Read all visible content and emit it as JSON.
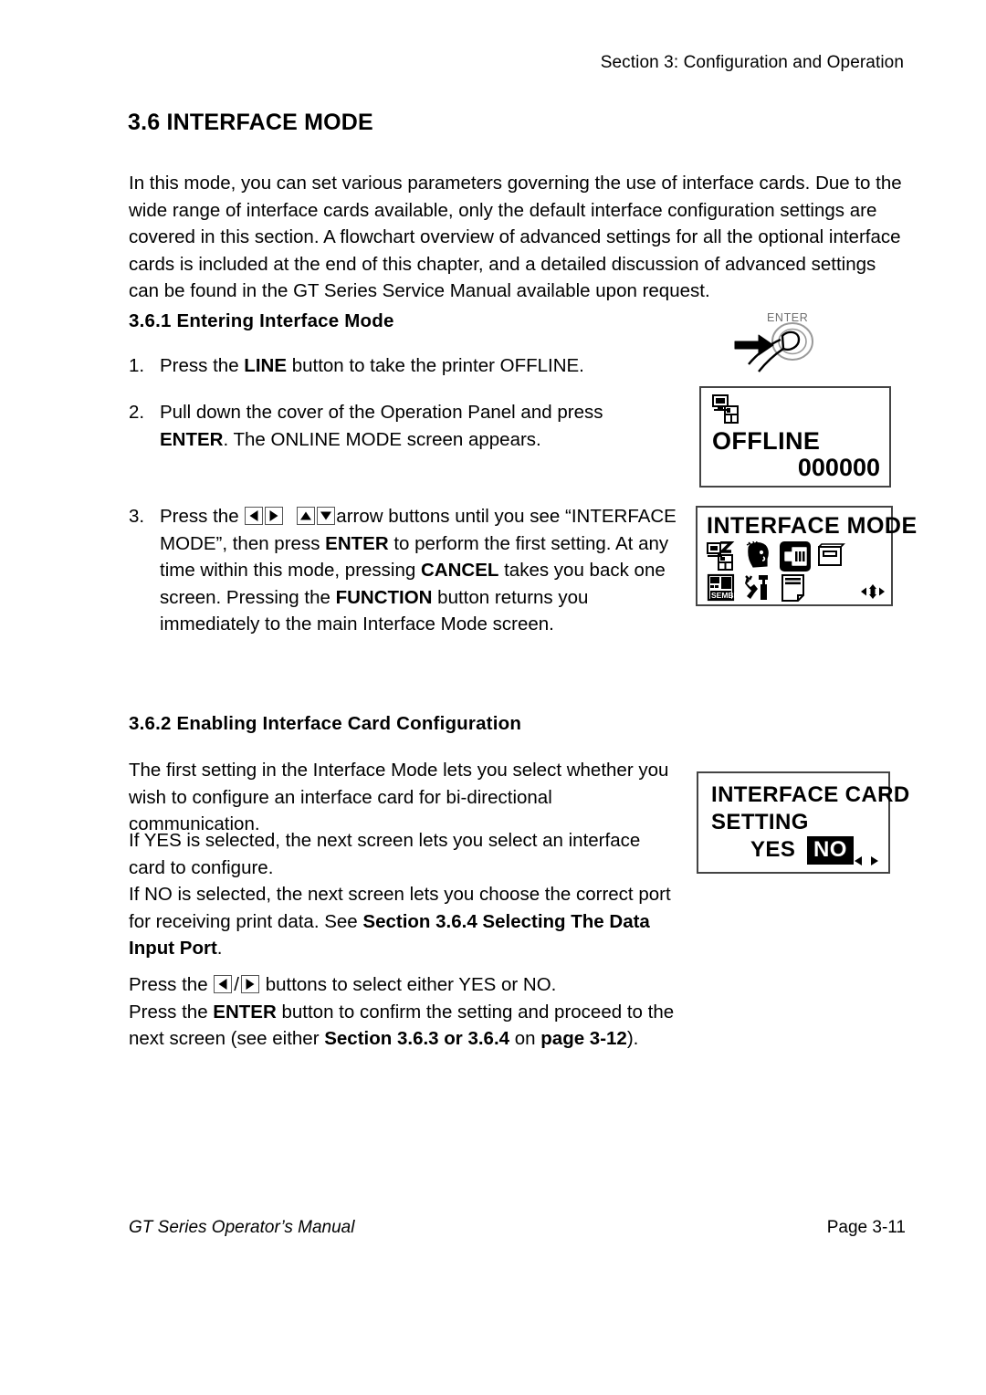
{
  "document": {
    "running_head": "Section 3: Configuration and Operation",
    "section_title": "3.6 INTERFACE MODE",
    "intro_paragraph": "In this mode, you can set various parameters governing the use of interface cards. Due to the wide range of interface cards available, only the default interface configuration settings are covered in this section. A flowchart overview of advanced settings for all the optional interface cards is included at the end of this chapter, and a detailed discussion of advanced settings can be found in the GT Series Service Manual available upon request."
  },
  "section_361": {
    "heading": "3.6.1 Entering Interface Mode",
    "steps": [
      {
        "number": "1.",
        "parts": [
          {
            "text": "Press the ",
            "bold": false
          },
          {
            "text": "LINE",
            "bold": true
          },
          {
            "text": " button to take the printer OFFLINE.",
            "bold": false
          }
        ]
      },
      {
        "number": "2.",
        "parts": [
          {
            "text": "Pull down the cover of the Operation Panel and press ",
            "bold": false
          },
          {
            "text": "ENTER",
            "bold": true
          },
          {
            "text": ". The ONLINE MODE screen appears.",
            "bold": false
          }
        ]
      },
      {
        "number": "3.",
        "lead": "Press the ",
        "parts": [
          {
            "text": "arrow buttons until you see “INTERFACE MODE”, then press ",
            "bold": false
          },
          {
            "text": "ENTER",
            "bold": true
          },
          {
            "text": " to perform the first setting. At any time within this mode, pressing ",
            "bold": false
          },
          {
            "text": "CANCEL",
            "bold": true
          },
          {
            "text": " takes you back one screen. Pressing the ",
            "bold": false
          },
          {
            "text": "FUNCTION",
            "bold": true
          },
          {
            "text": " button returns you immediately to the main Interface Mode screen.",
            "bold": false
          }
        ]
      }
    ]
  },
  "section_362": {
    "heading": "3.6.2 Enabling Interface Card Configuration",
    "para_a": "The first setting in the Interface Mode lets you select whether you wish to configure an interface card for bi-directional communication.",
    "para_b_parts": [
      {
        "text": "If YES is selected, the next screen lets you select an interface card to configure.",
        "bold": false
      },
      {
        "text": "\n",
        "bold": false
      },
      {
        "text": "If NO is selected, the next screen lets you choose the correct port for receiving print data. See ",
        "bold": false
      },
      {
        "text": "Section 3.6.4 Selecting The Data Input Port",
        "bold": true
      },
      {
        "text": ".",
        "bold": false
      }
    ],
    "para_c_line1_lead": "Press the ",
    "para_c_line1_tail": " buttons to select either YES or NO.",
    "para_c_line2_parts": [
      {
        "text": "Press the ",
        "bold": false
      },
      {
        "text": "ENTER",
        "bold": true
      },
      {
        "text": " button to confirm the setting and proceed to the next screen (see either ",
        "bold": false
      },
      {
        "text": "Section 3.6.3 or 3.6.4",
        "bold": true
      },
      {
        "text": " on ",
        "bold": false
      },
      {
        "text": "page 3-12",
        "bold": true
      },
      {
        "text": ").",
        "bold": false
      }
    ]
  },
  "illustration_enter": {
    "button_label": "ENTER",
    "description": "finger pressing ENTER button with arrow"
  },
  "lcd_offline": {
    "status_icons": [
      "computer-icon",
      "interface-card-icon"
    ],
    "line_main": "OFFLINE",
    "counter": "000000"
  },
  "lcd_interface_mode": {
    "title": "INTERFACE MODE",
    "icons": [
      {
        "name": "print-mode-icon",
        "selected": false
      },
      {
        "name": "user-head-icon",
        "selected": false
      },
      {
        "name": "interface-card-icon",
        "selected": true
      },
      {
        "name": "memory-card-icon",
        "selected": false
      },
      {
        "name": "sembl-panel-icon",
        "selected": false
      },
      {
        "name": "service-tools-icon",
        "selected": false
      },
      {
        "name": "page-document-icon",
        "selected": false
      }
    ],
    "nav_hint": "four-way-arrow-icon"
  },
  "lcd_interface_card_setting": {
    "line1": "INTERFACE CARD",
    "line2": "SETTING",
    "option_yes": "YES",
    "option_no": "NO",
    "selected_option": "NO",
    "nav_hint": "left-right-arrow-icon"
  },
  "footer": {
    "left": "GT Series Operator’s Manual",
    "right": "Page 3-11"
  },
  "colors": {
    "text": "#000000",
    "page_background": "#ffffff",
    "lcd_border": "#444444",
    "key_border": "#555555",
    "enter_label": "#6f6f6f"
  }
}
